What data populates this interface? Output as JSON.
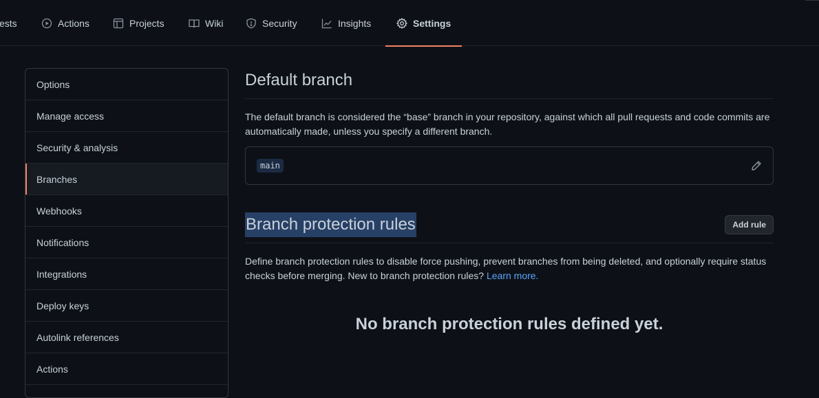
{
  "nav": {
    "tabs": [
      {
        "label": "ests",
        "icon": "none"
      },
      {
        "label": "Actions",
        "icon": "play-icon"
      },
      {
        "label": "Projects",
        "icon": "project-icon"
      },
      {
        "label": "Wiki",
        "icon": "book-icon"
      },
      {
        "label": "Security",
        "icon": "shield-icon"
      },
      {
        "label": "Insights",
        "icon": "graph-icon"
      },
      {
        "label": "Settings",
        "icon": "gear-icon",
        "active": true
      }
    ]
  },
  "sidebar": {
    "items": [
      {
        "label": "Options"
      },
      {
        "label": "Manage access"
      },
      {
        "label": "Security & analysis"
      },
      {
        "label": "Branches",
        "selected": true
      },
      {
        "label": "Webhooks"
      },
      {
        "label": "Notifications"
      },
      {
        "label": "Integrations"
      },
      {
        "label": "Deploy keys"
      },
      {
        "label": "Autolink references"
      },
      {
        "label": "Actions"
      }
    ]
  },
  "default_branch": {
    "title": "Default branch",
    "description": "The default branch is considered the “base” branch in your repository, against which all pull requests and code commits are automatically made, unless you specify a different branch.",
    "branch_name": "main"
  },
  "protection": {
    "title": "Branch protection rules",
    "add_rule_label": "Add rule",
    "description": "Define branch protection rules to disable force pushing, prevent branches from being deleted, and optionally require status checks before merging. New to branch protection rules?",
    "learn_more": "Learn more.",
    "empty_message": "No branch protection rules defined yet."
  },
  "colors": {
    "background": "#0d1117",
    "accent": "#f78166",
    "link": "#58a6ff",
    "text": "#c9d1d9"
  }
}
